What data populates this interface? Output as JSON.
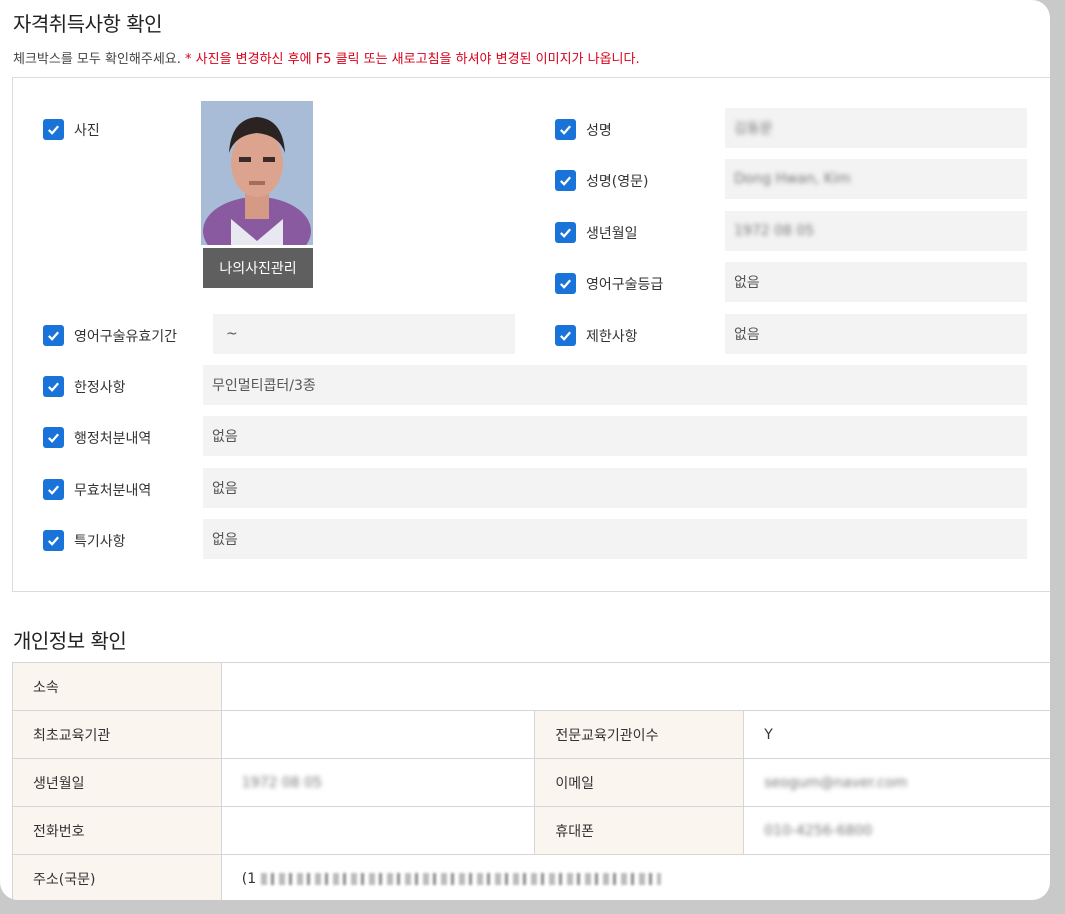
{
  "section1": {
    "title": "자격취득사항 확인",
    "notice_prefix": "체크박스를 모두 확인해주세요.",
    "notice_red": "* 사진을 변경하신 후에 F5 클릭 또는 새로고침을 하셔야 변경된 이미지가 나옵니다."
  },
  "photo": {
    "label": "사진",
    "button": "나의사진관리"
  },
  "right_fields": [
    {
      "label": "성명",
      "value": "김동문"
    },
    {
      "label": "성명(영문)",
      "value": "Dong Hwan, Kim"
    },
    {
      "label": "생년월일",
      "value": "1972 08 05"
    },
    {
      "label": "영어구술등급",
      "value": "없음"
    },
    {
      "label": "제한사항",
      "value": "없음"
    }
  ],
  "english_period": {
    "label": "영어구술유효기간",
    "value": "~"
  },
  "wide_fields": [
    {
      "label": "한정사항",
      "value": "무인멀티콥터/3종"
    },
    {
      "label": "행정처분내역",
      "value": "없음"
    },
    {
      "label": "무효처분내역",
      "value": "없음"
    },
    {
      "label": "특기사항",
      "value": "없음"
    }
  ],
  "section2": {
    "title": "개인정보 확인",
    "rows": {
      "affiliation": {
        "label": "소속",
        "value": ""
      },
      "first_edu": {
        "label": "최초교육기관",
        "value": ""
      },
      "pro_edu": {
        "label": "전문교육기관이수",
        "value": "Y"
      },
      "birth": {
        "label": "생년월일",
        "value": "1972 08 05"
      },
      "email": {
        "label": "이메일",
        "value": "seogum@naver.com"
      },
      "phone": {
        "label": "전화번호",
        "value": ""
      },
      "mobile": {
        "label": "휴대폰",
        "value": "010-4256-6800"
      },
      "address": {
        "label": "주소(국문)",
        "value": "(1"
      }
    }
  },
  "colors": {
    "checkbox": "#1a73d9",
    "notice_red": "#d9001b",
    "table_header_bg": "#fbf5ef",
    "field_bg": "#f3f3f3",
    "photo_button_bg": "#5f5f5f"
  },
  "icons": {
    "checkbox": "check-icon"
  }
}
